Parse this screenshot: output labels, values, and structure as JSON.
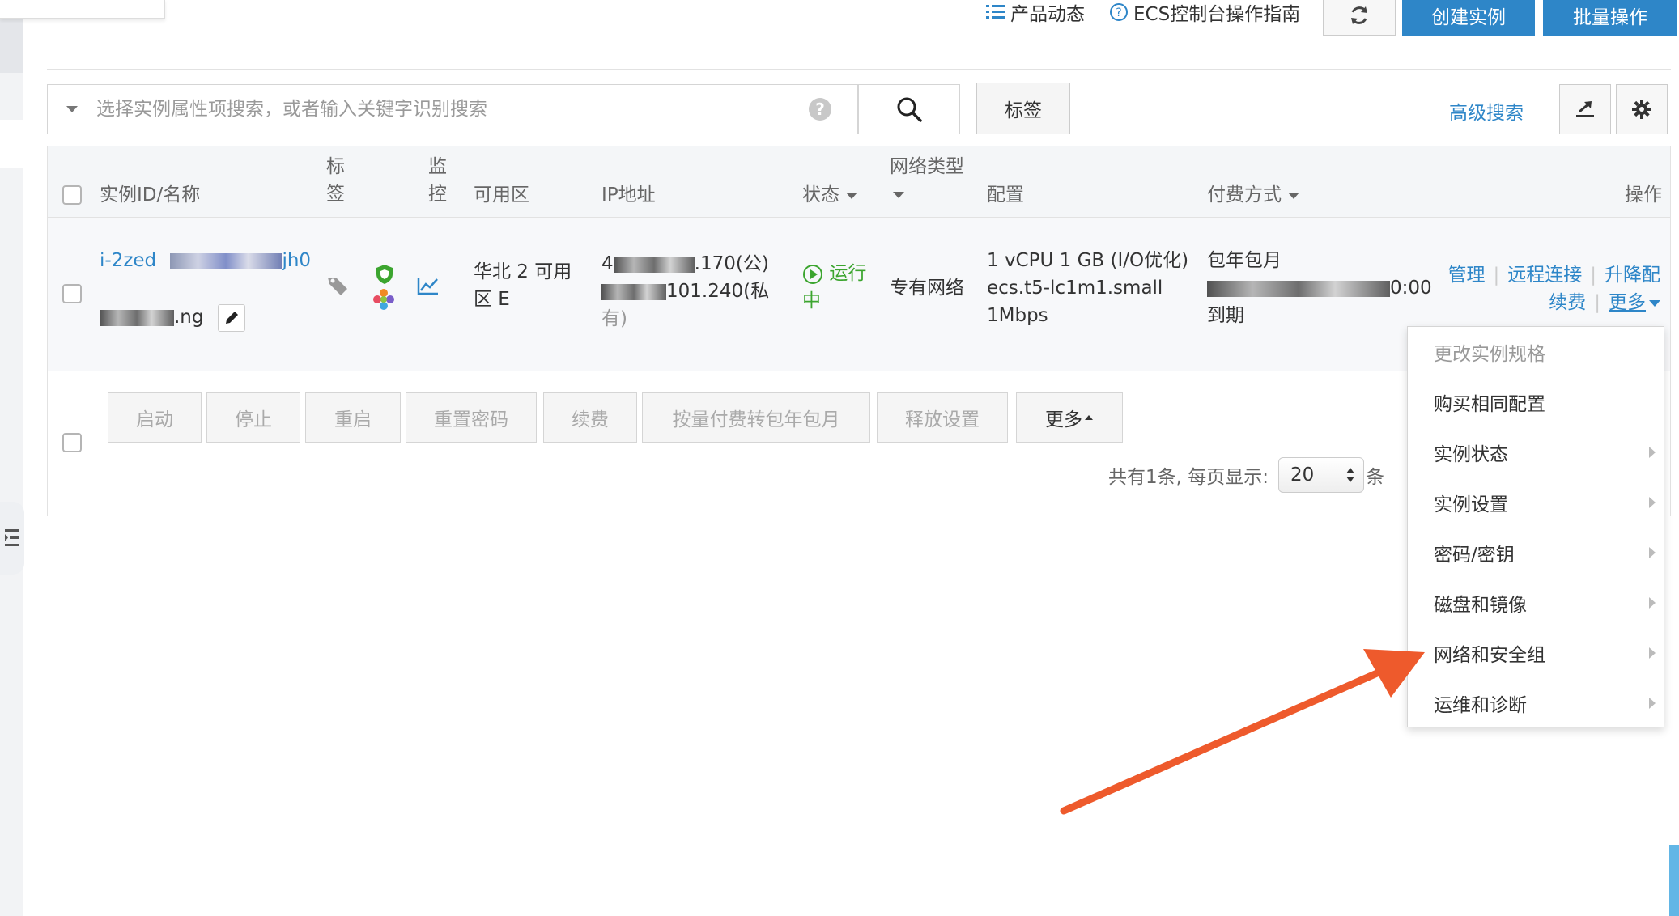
{
  "topbar": {
    "product_news": "产品动态",
    "ecs_guide": "ECS控制台操作指南",
    "create_instance": "创建实例",
    "batch_ops": "批量操作"
  },
  "search": {
    "placeholder": "选择实例属性项搜索，或者输入关键字识别搜索",
    "tag_button": "标签",
    "advanced_search": "高级搜索"
  },
  "table": {
    "headers": {
      "instance": "实例ID/名称",
      "tag_l1": "标",
      "tag_l2": "签",
      "monitor_l1": "监",
      "monitor_l2": "控",
      "zone": "可用区",
      "ip": "IP地址",
      "status": "状态",
      "network": "网络类型",
      "config": "配置",
      "billing": "付费方式",
      "ops": "操作"
    },
    "row": {
      "id_prefix": "i-2zed",
      "id_suffix": "jh0",
      "name_suffix": ".ng",
      "zone_l1": "华北 2 可用",
      "zone_l2": "区 E",
      "ip_public_prefix": "4",
      "ip_public_suffix": ".170(公)",
      "ip_private_suffix": "101.240(私",
      "ip_private_end": "有)",
      "status_l1": "运行",
      "status_l2": "中",
      "network": "专有网络",
      "config_l1": "1 vCPU 1 GB (I/O优化)",
      "config_l2": "ecs.t5-lc1m1.small",
      "config_l3": "1Mbps",
      "billing_l1": "包年包月",
      "billing_time_suffix": "0:00",
      "billing_l3": "到期",
      "op_manage": "管理",
      "op_remote": "远程连接",
      "op_resize": "升降配",
      "op_renew": "续费",
      "op_more": "更多"
    }
  },
  "actions": {
    "start": "启动",
    "stop": "停止",
    "restart": "重启",
    "reset_password": "重置密码",
    "renew": "续费",
    "convert": "按量付费转包年包月",
    "release": "释放设置",
    "more": "更多"
  },
  "pager": {
    "total": "共有1条, 每页显示:",
    "size": "20",
    "unit": "条"
  },
  "dropdown": {
    "items": [
      "更改实例规格",
      "购买相同配置",
      "实例状态",
      "实例设置",
      "密码/密钥",
      "磁盘和镜像",
      "网络和安全组",
      "运维和诊断"
    ]
  },
  "colors": {
    "accent": "#2e86c8",
    "running": "#3ca52f",
    "arrow": "#ee5a2c"
  }
}
